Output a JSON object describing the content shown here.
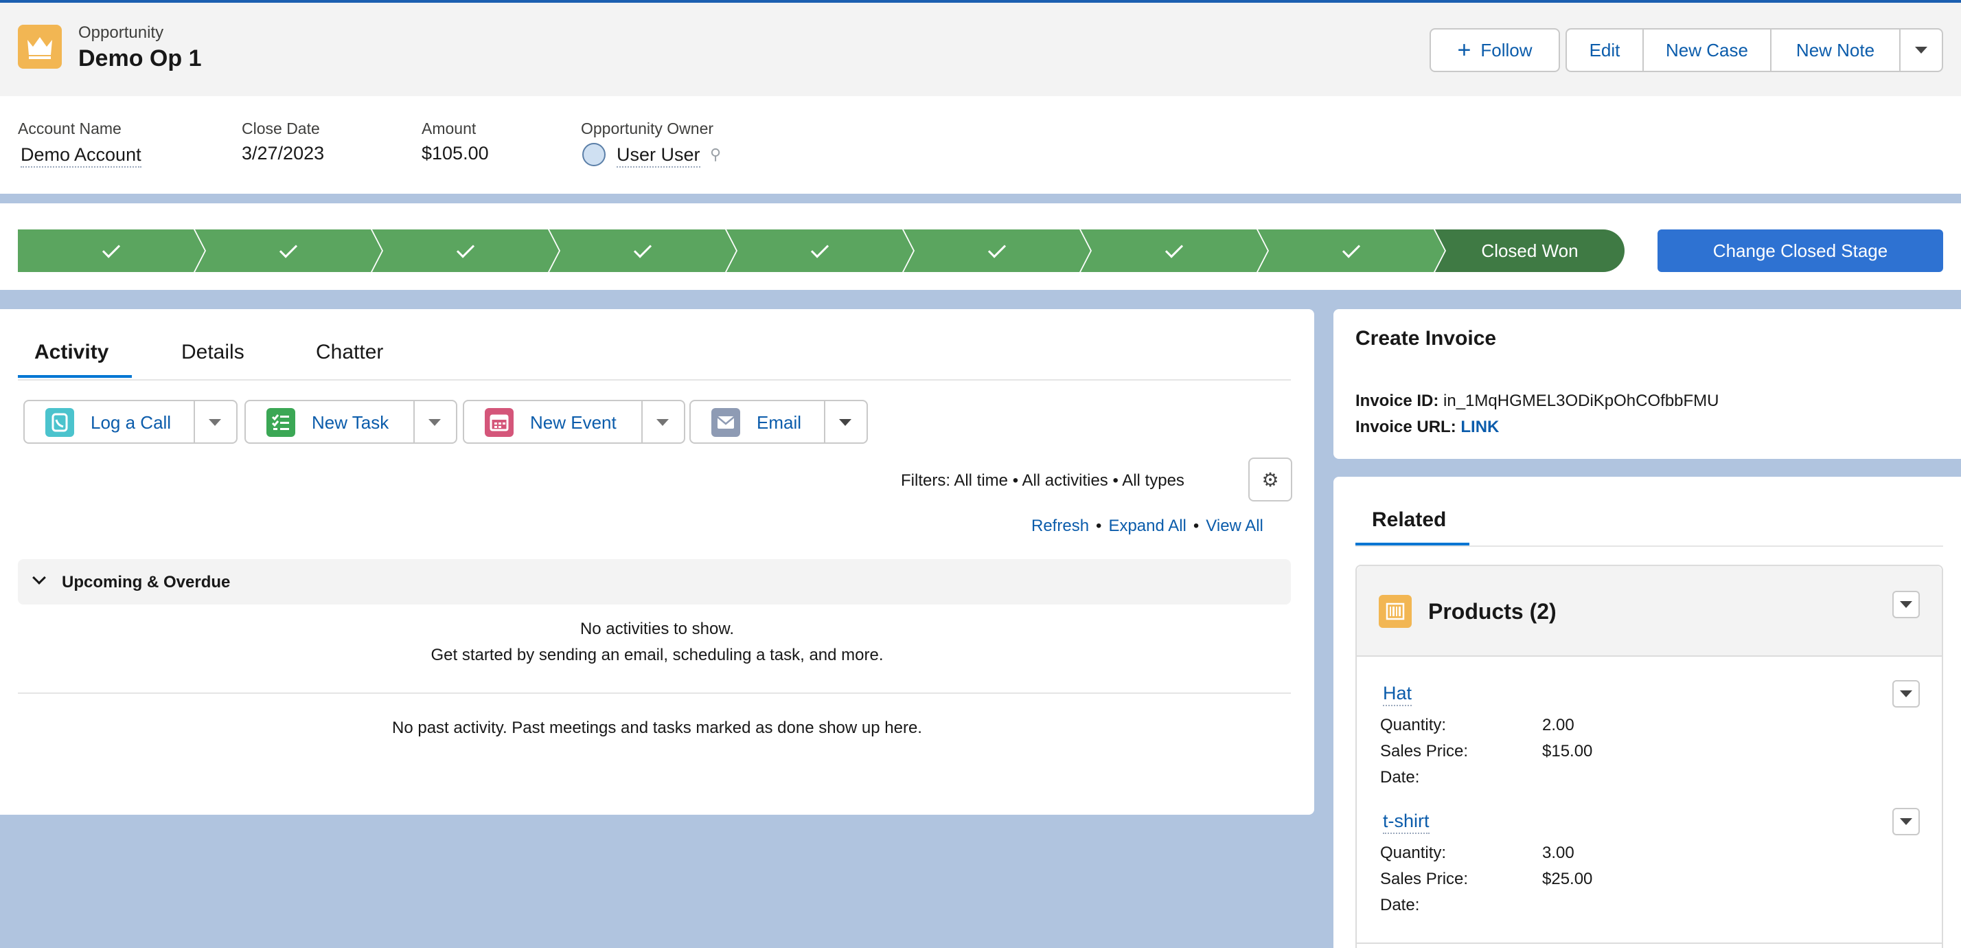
{
  "header": {
    "object_type": "Opportunity",
    "record_name": "Demo Op 1",
    "buttons": {
      "follow": "Follow",
      "edit": "Edit",
      "new_case": "New Case",
      "new_note": "New Note"
    }
  },
  "fields": [
    {
      "label": "Account Name",
      "value": "Demo Account"
    },
    {
      "label": "Close Date",
      "value": "3/27/2023"
    },
    {
      "label": "Amount",
      "value": "$105.00"
    },
    {
      "label": "Opportunity Owner",
      "value": "User User"
    }
  ],
  "path": {
    "completed_stages": 8,
    "current_stage": "Closed Won",
    "action_button": "Change Closed Stage"
  },
  "activity": {
    "tabs": [
      "Activity",
      "Details",
      "Chatter"
    ],
    "active_tab": "Activity",
    "actions": [
      {
        "label": "Log a Call",
        "icon": "phone-icon"
      },
      {
        "label": "New Task",
        "icon": "task-icon"
      },
      {
        "label": "New Event",
        "icon": "calendar-icon"
      },
      {
        "label": "Email",
        "icon": "email-icon"
      }
    ],
    "filters": "Filters: All time • All activities • All types",
    "links": {
      "refresh": "Refresh",
      "expand_all": "Expand All",
      "view_all": "View All"
    },
    "separator": "•",
    "upcoming_heading": "Upcoming & Overdue",
    "no_activities": "No activities to show.",
    "get_started": "Get started by sending an email, scheduling a task, and more.",
    "no_past": "No past activity. Past meetings and tasks marked as done show up here."
  },
  "invoice": {
    "title": "Create Invoice",
    "id_label": "Invoice ID:",
    "id_value": "in_1MqHGMEL3ODiKpOhCOfbbFMU",
    "url_label": "Invoice URL:",
    "url_value": "LINK"
  },
  "related": {
    "tab": "Related",
    "products_title": "Products (2)",
    "products": [
      {
        "name": "Hat",
        "quantity_label": "Quantity:",
        "quantity": "2.00",
        "price_label": "Sales Price:",
        "price": "$15.00",
        "date_label": "Date:"
      },
      {
        "name": "t-shirt",
        "quantity_label": "Quantity:",
        "quantity": "3.00",
        "price_label": "Sales Price:",
        "price": "$25.00",
        "date_label": "Date:"
      }
    ]
  },
  "colors": {
    "path_complete": "#5ba55f",
    "path_current": "#3f7a44",
    "brand_blue": "#2e72d2",
    "link": "#0b5cab",
    "opportunity_icon": "#f2b653"
  }
}
